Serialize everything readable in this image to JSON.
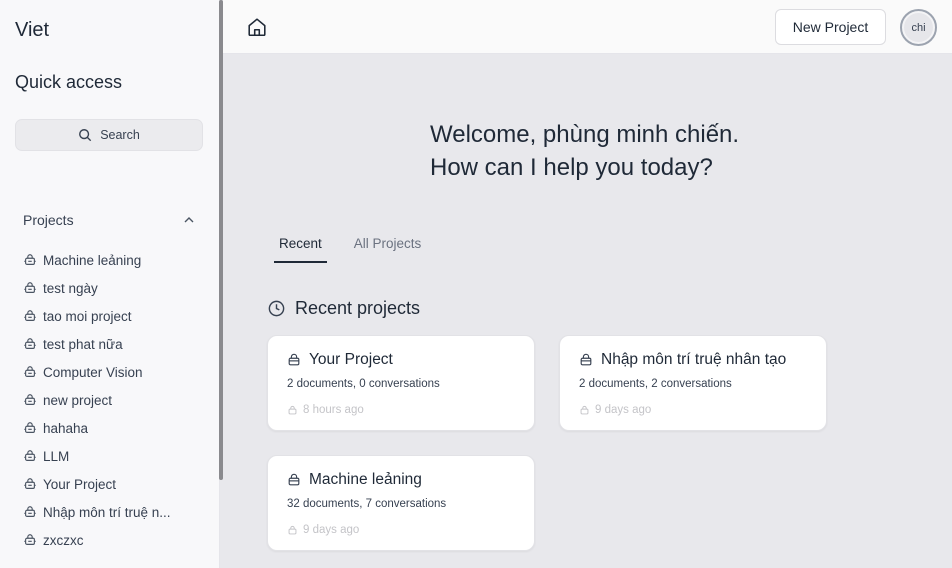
{
  "sidebar": {
    "brand": "Viet",
    "quick_access": "Quick access",
    "search_label": "Search",
    "projects_heading": "Projects",
    "items": [
      {
        "label": "Machine leảning"
      },
      {
        "label": "test ngày"
      },
      {
        "label": "tao moi project"
      },
      {
        "label": "test phat nữa"
      },
      {
        "label": "Computer Vision"
      },
      {
        "label": "new project"
      },
      {
        "label": "hahaha"
      },
      {
        "label": "LLM"
      },
      {
        "label": "Your Project"
      },
      {
        "label": "Nhập môn trí truệ n..."
      },
      {
        "label": "zxczxc"
      }
    ]
  },
  "header": {
    "new_project_label": "New Project",
    "avatar_text": "chi"
  },
  "main": {
    "welcome_line1": "Welcome, phùng minh chiến.",
    "welcome_line2": "How can I help you today?",
    "tabs": [
      {
        "label": "Recent",
        "active": true
      },
      {
        "label": "All Projects",
        "active": false
      }
    ],
    "recent_heading": "Recent projects",
    "cards": [
      {
        "title": "Your Project",
        "meta": "2 documents, 0 conversations",
        "time": "8 hours ago"
      },
      {
        "title": "Nhập môn trí truệ nhân tạo",
        "meta": "2 documents, 2 conversations",
        "time": "9 days ago"
      },
      {
        "title": "Machine leảning",
        "meta": "32 documents, 7 conversations",
        "time": "9 days ago"
      }
    ]
  },
  "icons": {
    "home": "home-icon",
    "search": "search-icon",
    "chevron": "chevron-up-icon",
    "project": "project-icon",
    "clock": "clock-icon"
  }
}
